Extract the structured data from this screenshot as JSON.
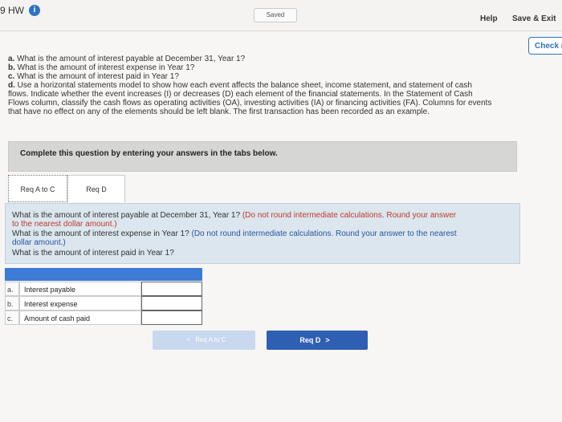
{
  "header": {
    "hw_title": "9 HW",
    "saved_label": "Saved",
    "help_label": "Help",
    "save_exit_label": "Save & Exit",
    "check_label": "Check m"
  },
  "questions": {
    "a_label": "a.",
    "a_text": "What is the amount of interest payable at December 31, Year 1?",
    "b_label": "b.",
    "b_text": "What is the amount of interest expense in Year 1?",
    "c_label": "c.",
    "c_text": "What is the amount of interest paid in Year 1?",
    "d_label": "d.",
    "d_line1": "Use a horizontal statements model to show how each event affects the balance sheet, income statement, and statement of cash",
    "d_line2": "flows. Indicate whether the event increases (I) or decreases (D) each element of the financial statements. In the Statement of Cash",
    "d_line3": "Flows column, classify the cash flows as operating activities (OA), investing activities (IA) or financing activities (FA). Columns for events",
    "d_line4": "that have no effect on any of the elements should be left blank. The first transaction has been recorded as an example."
  },
  "instruction": "Complete this question by entering your answers in the tabs below.",
  "tabs": [
    {
      "label": "Req A to C"
    },
    {
      "label": "Req D"
    }
  ],
  "panel": {
    "q1_text": "What is the amount of interest payable at December 31, Year 1?",
    "q1_note_line1": "(Do not round intermediate calculations. Round your answer",
    "q1_note_line2": "to the nearest dollar amount.)",
    "q2_text": "What is the amount of interest expense in Year 1?",
    "q2_note_line1": "(Do not round intermediate calculations. Round your answer to the nearest",
    "q2_note_line2": "dollar amount.)",
    "q3_text": "What is the amount of interest paid in Year 1?"
  },
  "answer_table": {
    "rows": [
      {
        "letter": "a.",
        "label": "Interest payable",
        "value": ""
      },
      {
        "letter": "b.",
        "label": "Interest expense",
        "value": ""
      },
      {
        "letter": "c.",
        "label": "Amount of cash paid",
        "value": ""
      }
    ]
  },
  "nav": {
    "prev_label": "Req A to C",
    "next_label": "Req D"
  },
  "colors": {
    "accent": "#2f72c4",
    "table_header": "#3c7cd6",
    "panel_bg": "#dbe6ee",
    "note_red": "#c0392b",
    "note_blue": "#2a55a0"
  }
}
